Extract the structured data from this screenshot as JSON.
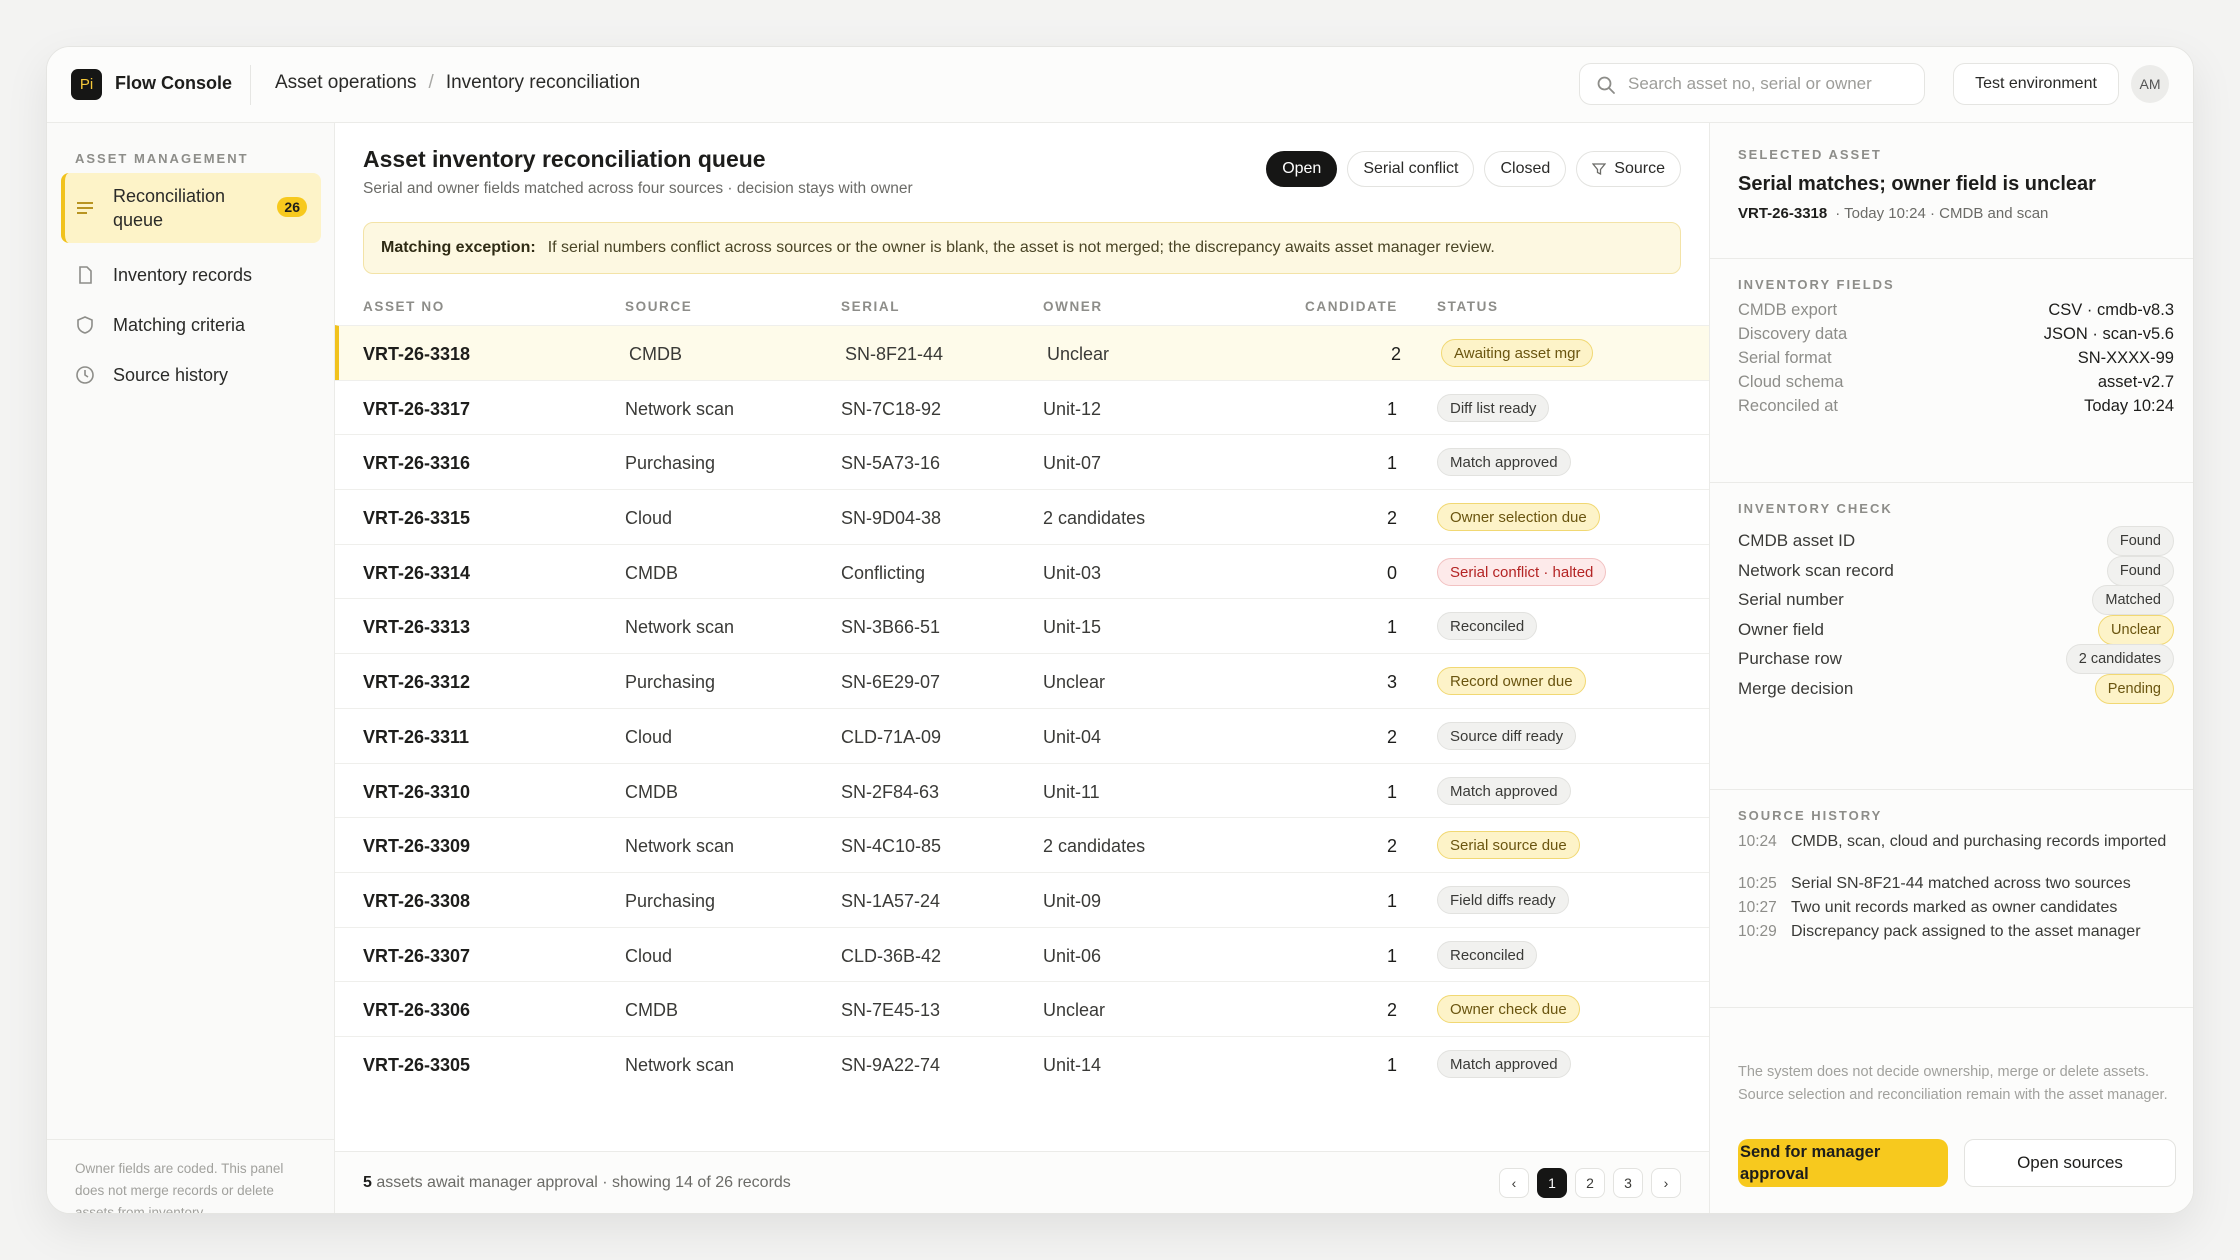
{
  "app": {
    "logo": "Pi",
    "name": "Flow Console"
  },
  "breadcrumb": [
    "Asset operations",
    "/",
    "Inventory reconciliation"
  ],
  "search": {
    "placeholder": "Search asset no, serial or owner"
  },
  "env_button": "Test environment",
  "avatar": "AM",
  "sidebar": {
    "section": "ASSET MANAGEMENT",
    "items": [
      {
        "label": "Reconciliation queue",
        "badge": "26",
        "icon": "list-icon",
        "active": true
      },
      {
        "label": "Inventory records",
        "icon": "document-icon"
      },
      {
        "label": "Matching criteria",
        "icon": "shield-icon"
      },
      {
        "label": "Source history",
        "icon": "clock-icon"
      }
    ],
    "note": "Owner fields are coded. This panel does not merge records or delete assets from inventory."
  },
  "main": {
    "title": "Asset inventory reconciliation queue",
    "subtitle": "Serial and owner fields matched across four sources · decision stays with owner",
    "filters": [
      "Open",
      "Serial conflict",
      "Closed",
      "Source"
    ],
    "exception_label": "Matching exception:",
    "exception_text": "If serial numbers conflict across sources or the owner is blank, the asset is not merged; the discrepancy awaits asset manager review.",
    "columns": [
      "ASSET NO",
      "SOURCE",
      "SERIAL",
      "OWNER",
      "CANDIDATE",
      "STATUS"
    ],
    "rows": [
      {
        "id": "VRT-26-3318",
        "source": "CMDB",
        "serial": "SN-8F21-44",
        "owner": "Unclear",
        "candidate": "2",
        "status": "Awaiting asset mgr",
        "tone": "yellow"
      },
      {
        "id": "VRT-26-3317",
        "source": "Network scan",
        "serial": "SN-7C18-92",
        "owner": "Unit-12",
        "candidate": "1",
        "status": "Diff list ready",
        "tone": "gray"
      },
      {
        "id": "VRT-26-3316",
        "source": "Purchasing",
        "serial": "SN-5A73-16",
        "owner": "Unit-07",
        "candidate": "1",
        "status": "Match approved",
        "tone": "gray"
      },
      {
        "id": "VRT-26-3315",
        "source": "Cloud",
        "serial": "SN-9D04-38",
        "owner": "2 candidates",
        "candidate": "2",
        "status": "Owner selection due",
        "tone": "yellow"
      },
      {
        "id": "VRT-26-3314",
        "source": "CMDB",
        "serial": "Conflicting",
        "owner": "Unit-03",
        "candidate": "0",
        "status": "Serial conflict · halted",
        "tone": "red"
      },
      {
        "id": "VRT-26-3313",
        "source": "Network scan",
        "serial": "SN-3B66-51",
        "owner": "Unit-15",
        "candidate": "1",
        "status": "Reconciled",
        "tone": "gray"
      },
      {
        "id": "VRT-26-3312",
        "source": "Purchasing",
        "serial": "SN-6E29-07",
        "owner": "Unclear",
        "candidate": "3",
        "status": "Record owner due",
        "tone": "yellow"
      },
      {
        "id": "VRT-26-3311",
        "source": "Cloud",
        "serial": "CLD-71A-09",
        "owner": "Unit-04",
        "candidate": "2",
        "status": "Source diff ready",
        "tone": "gray"
      },
      {
        "id": "VRT-26-3310",
        "source": "CMDB",
        "serial": "SN-2F84-63",
        "owner": "Unit-11",
        "candidate": "1",
        "status": "Match approved",
        "tone": "gray"
      },
      {
        "id": "VRT-26-3309",
        "source": "Network scan",
        "serial": "SN-4C10-85",
        "owner": "2 candidates",
        "candidate": "2",
        "status": "Serial source due",
        "tone": "yellow"
      },
      {
        "id": "VRT-26-3308",
        "source": "Purchasing",
        "serial": "SN-1A57-24",
        "owner": "Unit-09",
        "candidate": "1",
        "status": "Field diffs ready",
        "tone": "gray"
      },
      {
        "id": "VRT-26-3307",
        "source": "Cloud",
        "serial": "CLD-36B-42",
        "owner": "Unit-06",
        "candidate": "1",
        "status": "Reconciled",
        "tone": "gray"
      },
      {
        "id": "VRT-26-3306",
        "source": "CMDB",
        "serial": "SN-7E45-13",
        "owner": "Unclear",
        "candidate": "2",
        "status": "Owner check due",
        "tone": "yellow"
      },
      {
        "id": "VRT-26-3305",
        "source": "Network scan",
        "serial": "SN-9A22-74",
        "owner": "Unit-14",
        "candidate": "1",
        "status": "Match approved",
        "tone": "gray"
      }
    ],
    "footer_count": "5",
    "footer_text": "assets await manager approval · showing 14 of 26 records",
    "pages": [
      "‹",
      "1",
      "2",
      "3",
      "›"
    ]
  },
  "panel": {
    "selected_label": "SELECTED ASSET",
    "title": "Serial matches; owner field is unclear",
    "asset_id": "VRT-26-3318",
    "meta": "· Today 10:24 · CMDB and scan",
    "fields_label": "INVENTORY FIELDS",
    "fields": [
      {
        "k": "CMDB export",
        "v": "CSV · cmdb-v8.3"
      },
      {
        "k": "Discovery data",
        "v": "JSON · scan-v5.6"
      },
      {
        "k": "Serial format",
        "v": "SN-XXXX-99"
      },
      {
        "k": "Cloud schema",
        "v": "asset-v2.7"
      },
      {
        "k": "Reconciled at",
        "v": "Today 10:24"
      }
    ],
    "check_label": "INVENTORY CHECK",
    "checks": [
      {
        "k": "CMDB asset ID",
        "v": "Found",
        "tone": "gray"
      },
      {
        "k": "Network scan record",
        "v": "Found",
        "tone": "gray"
      },
      {
        "k": "Serial number",
        "v": "Matched",
        "tone": "gray"
      },
      {
        "k": "Owner field",
        "v": "Unclear",
        "tone": "yellow"
      },
      {
        "k": "Purchase row",
        "v": "2 candidates",
        "tone": "gray"
      },
      {
        "k": "Merge decision",
        "v": "Pending",
        "tone": "yellow"
      }
    ],
    "history_label": "SOURCE HISTORY",
    "history": [
      {
        "t": "10:24",
        "d": "CMDB, scan, cloud and purchasing records imported"
      },
      {
        "t": "10:25",
        "d": "Serial SN-8F21-44 matched across two sources"
      },
      {
        "t": "10:27",
        "d": "Two unit records marked as owner candidates"
      },
      {
        "t": "10:29",
        "d": "Discrepancy pack assigned to the asset manager"
      }
    ],
    "note": "The system does not decide ownership, merge or delete assets. Source selection and reconciliation remain with the asset manager.",
    "primary_button": [
      "Send for manager",
      "approval"
    ],
    "secondary_button": "Open sources"
  }
}
